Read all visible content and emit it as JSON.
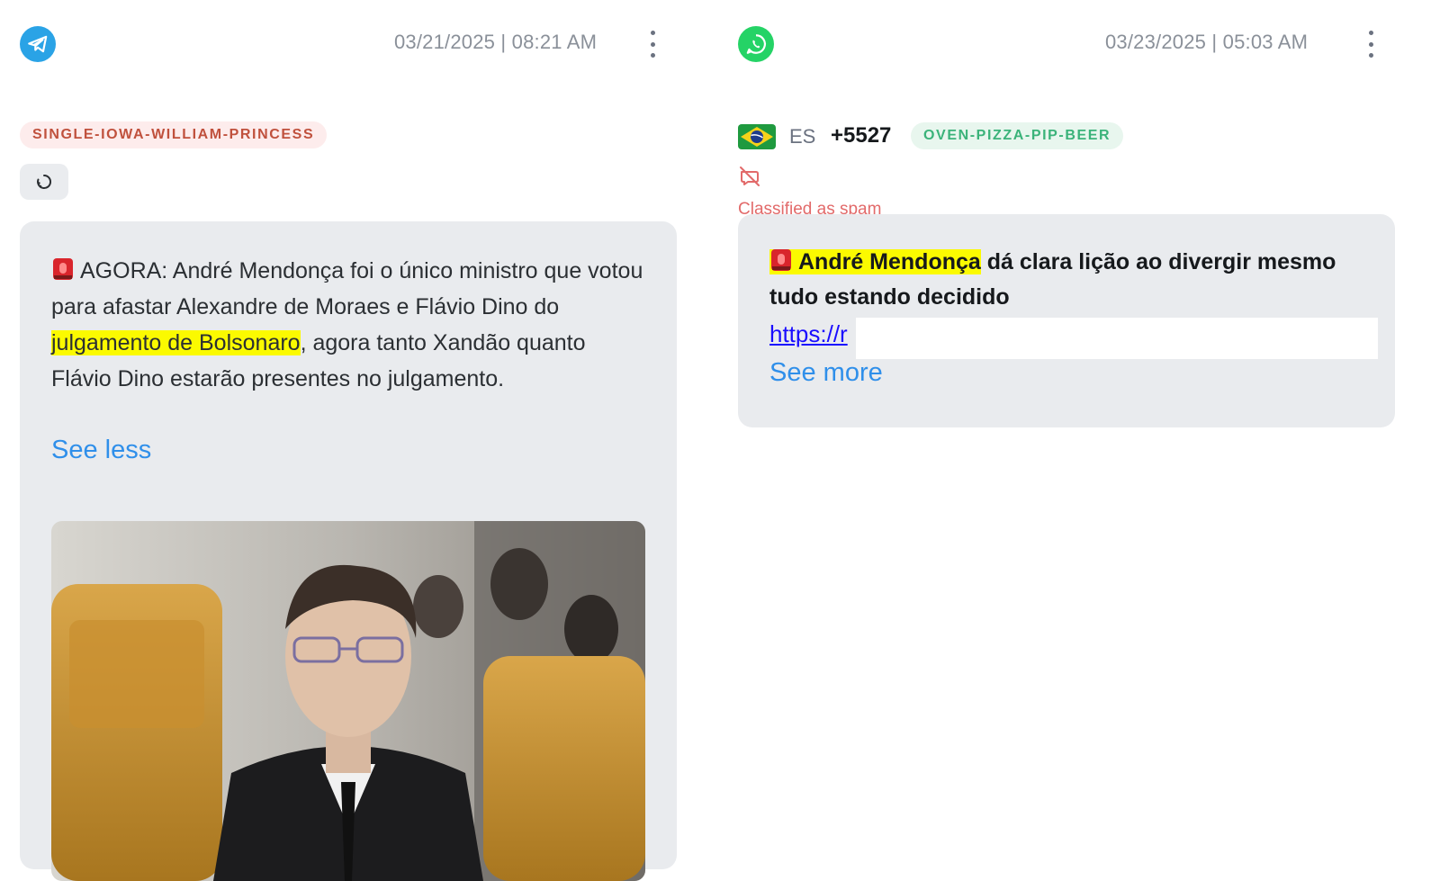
{
  "posts": [
    {
      "platform_icon": "telegram-icon",
      "timestamp": "03/21/2025 | 08:21 AM",
      "tag": "SINGLE-IOWA-WILLIAM-PRINCESS",
      "message": {
        "emoji": "🚨",
        "part1": "AGORA: André Mendonça foi o único ministro que votou para afastar Alexandre de Moraes e Flávio Dino do ",
        "highlight": "julgamento de Bolsonaro",
        "part2": ", agora tanto Xandão quanto Flávio Dino estarão presentes no julgamento."
      },
      "toggle_label": "See less",
      "image_icon": "photo-icon"
    },
    {
      "platform_icon": "whatsapp-icon",
      "timestamp": "03/23/2025 | 05:03 AM",
      "country_flag": "brazil-flag-icon",
      "country_code": "ES",
      "phone": "+5527",
      "tag": "OVEN-PIZZA-PIP-BEER",
      "spam_icon": "spam-off-icon",
      "spam_label": "Classified as spam",
      "message": {
        "emoji": "🚨",
        "highlight": "André Mendonça",
        "part2": " dá clara lição ao divergir mesmo tudo estando decidido"
      },
      "link_text": "https://r",
      "toggle_label": "See more"
    }
  ],
  "colors": {
    "telegram": "#2aa3e6",
    "whatsapp": "#25d366",
    "highlight": "#fbfa00",
    "link": "#2f8fea",
    "spam": "#e26a6a"
  }
}
